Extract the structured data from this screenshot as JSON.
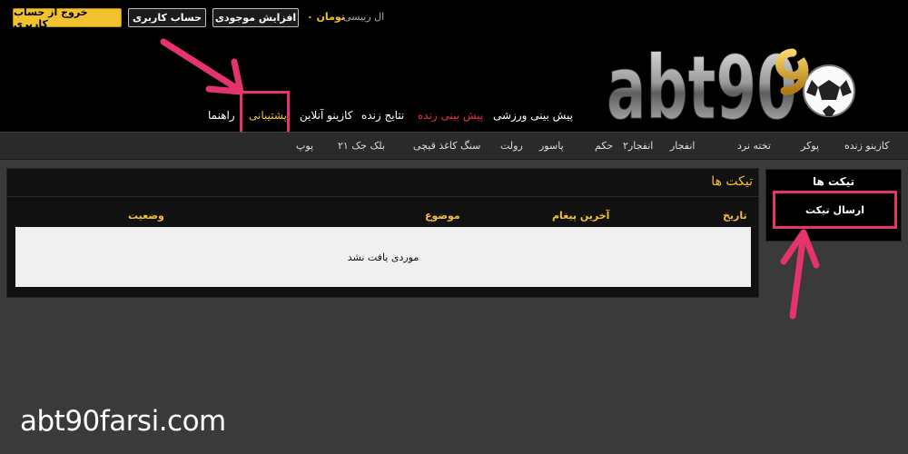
{
  "header": {
    "logout_label": "خروج از حساب کاربری",
    "account_label": "حساب کاربری",
    "deposit_label": "افزایش موجودی",
    "balance": "تومان ۰",
    "username": "ال رییسی",
    "logo_text": "abt90"
  },
  "main_nav": [
    {
      "label": "پیش بینی ورزشی"
    },
    {
      "label": "پیش بینی زنده"
    },
    {
      "label": "نتایج زنده"
    },
    {
      "label": "کازینو آنلاین"
    },
    {
      "label": "پشتیبانی"
    },
    {
      "label": "راهنما"
    }
  ],
  "sub_nav": [
    {
      "label": "کازینو زنده"
    },
    {
      "label": "پوکر"
    },
    {
      "label": "تخته نرد"
    },
    {
      "label": "انفجار"
    },
    {
      "label": "انفجار۲"
    },
    {
      "label": "حکم"
    },
    {
      "label": "پاسور"
    },
    {
      "label": "رولت"
    },
    {
      "label": "سنگ کاغذ قیچی"
    },
    {
      "label": "بلک جک ۲۱"
    },
    {
      "label": "پوپ"
    }
  ],
  "sidebar": {
    "title": "تیکت ها",
    "send_ticket_label": "ارسال تیکت"
  },
  "tickets": {
    "title": "تیکت ها",
    "columns": [
      "تاریخ",
      "آخرین پیغام",
      "موضوع",
      "وضعیت"
    ],
    "empty_message": "موردی یافت نشد"
  },
  "watermark": "abt90farsi.com",
  "colors": {
    "accent": "#f2c12e",
    "live": "#e8333d",
    "highlight": "#e5336c"
  }
}
